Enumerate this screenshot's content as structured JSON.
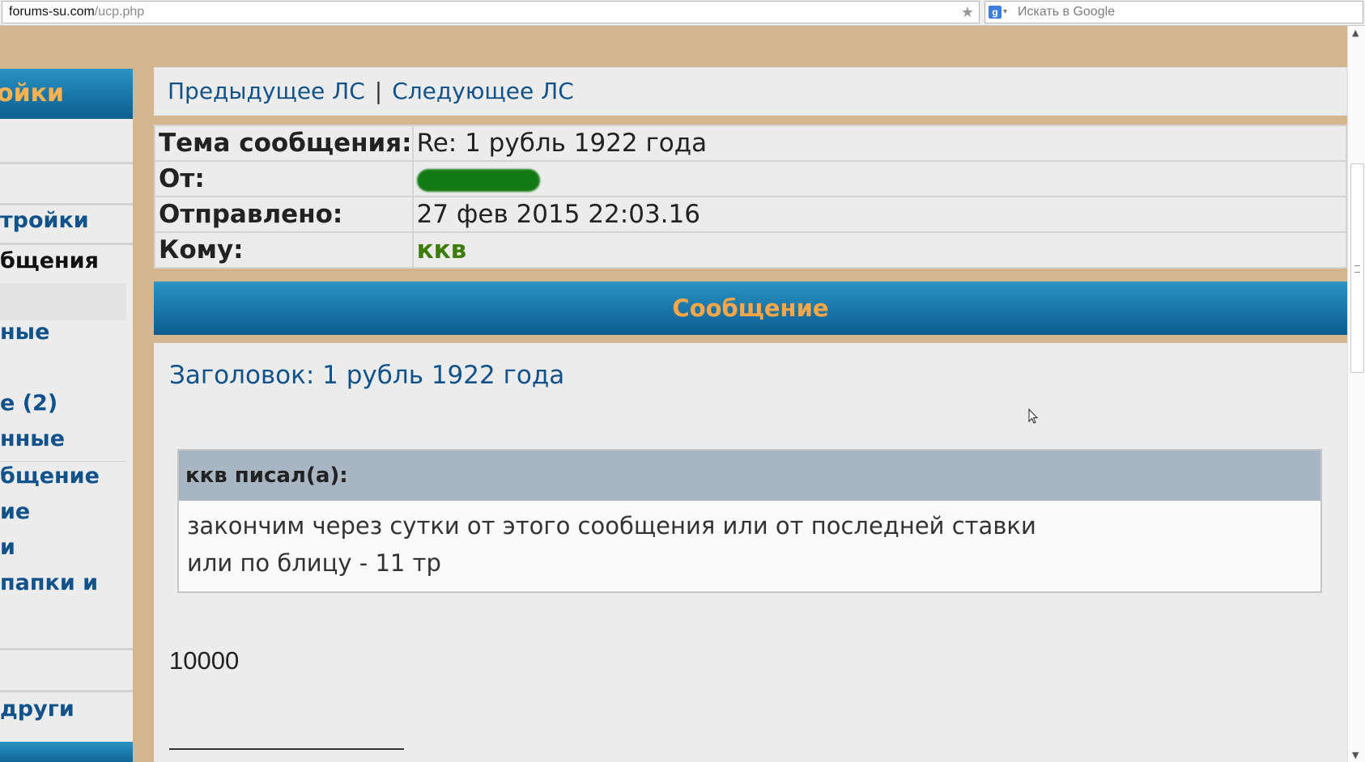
{
  "browser": {
    "url_host": "forums-su.com",
    "url_path": "/ucp.php",
    "search_placeholder": "Искать в Google"
  },
  "sidebar": {
    "header": "ойки",
    "items": [
      {
        "label": "тройки"
      },
      {
        "label": "бщения"
      },
      {
        "label": "ные"
      },
      {
        "label": "е (2)"
      },
      {
        "label": "нные"
      },
      {
        "label": "бщение"
      },
      {
        "label": "ие"
      },
      {
        "label": "и"
      },
      {
        "label": "папки и"
      },
      {
        "label": "други"
      }
    ]
  },
  "pm_nav": {
    "prev": "Предыдущее ЛС",
    "separator": "|",
    "next": "Следующее ЛС"
  },
  "header_rows": {
    "subject_label": "Тема сообщения:",
    "subject_value": "Re: 1 рубль 1922 года",
    "from_label": "От:",
    "sent_label": "Отправлено:",
    "sent_value": "27 фев 2015 22:03.16",
    "to_label": "Кому:",
    "to_value": "ккв"
  },
  "message": {
    "section_title": "Сообщение",
    "title": "Заголовок: 1 рубль 1922 года",
    "quote_author": "ккв писал(а):",
    "quote_lines": [
      "закончим через сутки от этого сообщения или от последней ставки",
      "или по блицу - 11 тр"
    ],
    "body": "10000"
  },
  "colors": {
    "page_bg": "#d3b58e",
    "header_blue": "#0c5f8f",
    "link_blue": "#105289",
    "section_orange": "#ffa646",
    "username_green": "#3d7b0b"
  }
}
